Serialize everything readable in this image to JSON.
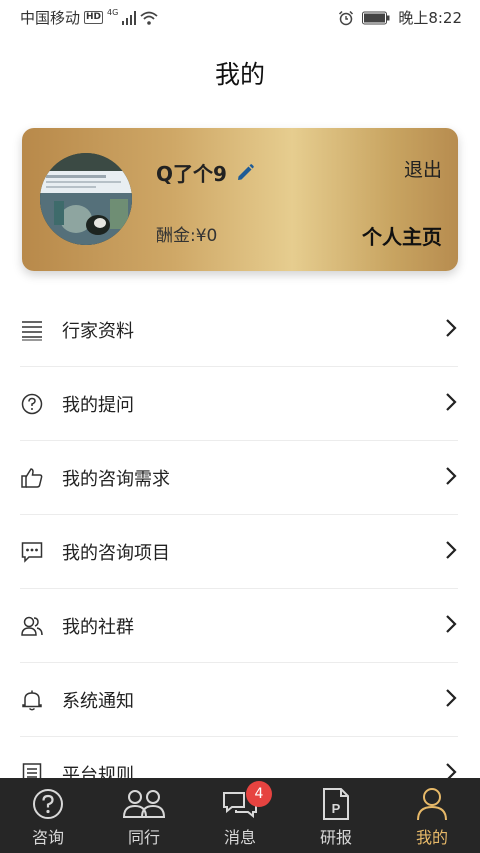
{
  "status_bar": {
    "carrier": "中国移动",
    "hd": "HD",
    "network": "4G",
    "time": "晚上8:22"
  },
  "page": {
    "title": "我的"
  },
  "profile": {
    "username": "Q了个9",
    "logout_label": "退出",
    "reward": "酬金:¥0",
    "homepage_label": "个人主页"
  },
  "menu": {
    "items": [
      {
        "label": "行家资料",
        "icon": "document-lines-icon"
      },
      {
        "label": "我的提问",
        "icon": "question-circle-icon"
      },
      {
        "label": "我的咨询需求",
        "icon": "thumbs-up-icon"
      },
      {
        "label": "我的咨询项目",
        "icon": "chat-dots-icon"
      },
      {
        "label": "我的社群",
        "icon": "group-icon"
      },
      {
        "label": "系统通知",
        "icon": "bell-icon"
      },
      {
        "label": "平台规则",
        "icon": "rules-document-icon"
      }
    ]
  },
  "tab_bar": {
    "tabs": [
      {
        "label": "咨询",
        "icon": "question-circle-icon"
      },
      {
        "label": "同行",
        "icon": "people-icon"
      },
      {
        "label": "消息",
        "icon": "chat-bubbles-icon",
        "badge": "4"
      },
      {
        "label": "研报",
        "icon": "report-document-icon"
      },
      {
        "label": "我的",
        "icon": "user-icon",
        "active": true
      }
    ],
    "active_color": "#e7b969"
  }
}
